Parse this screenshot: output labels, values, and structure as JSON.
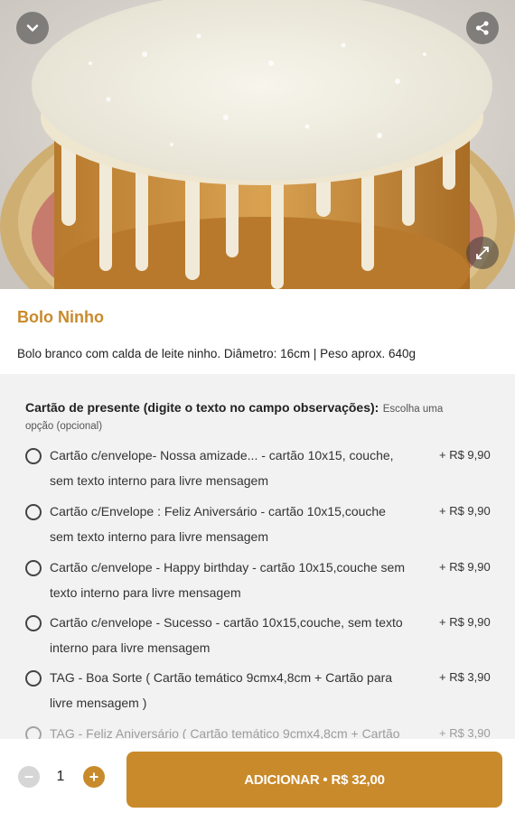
{
  "product": {
    "title": "Bolo Ninho",
    "description": "Bolo branco com calda de leite ninho. Diâmetro: 16cm | Peso aprox. 640g",
    "image_icon": "cake-photo"
  },
  "header_icons": {
    "back": "chevron-down-icon",
    "share": "share-icon",
    "expand": "expand-icon"
  },
  "option_group": {
    "title": "Cartão de presente (digite o texto no campo observações):",
    "hint_line1": "Escolha uma",
    "hint_line2": "opção (opcional)",
    "options": [
      {
        "line1": "Cartão c/envelope- Nossa amizade... - cartão 10x15, couche,",
        "line2": "sem texto interno para livre mensagem",
        "price": "+ R$ 9,90"
      },
      {
        "line1": "Cartão c/Envelope : Feliz Aniversário - cartão 10x15,couche",
        "line2": "sem texto interno para livre mensagem",
        "price": "+ R$ 9,90"
      },
      {
        "line1": "Cartão c/envelope - Happy birthday - cartão 10x15,couche sem",
        "line2": "texto interno para livre mensagem",
        "price": "+ R$ 9,90"
      },
      {
        "line1": "Cartão c/envelope - Sucesso - cartão 10x15,couche, sem texto",
        "line2": "interno para livre mensagem",
        "price": "+ R$ 9,90"
      },
      {
        "line1": "TAG - Boa Sorte ( Cartão temático 9cmx4,8cm + Cartão para",
        "line2": "livre mensagem )",
        "price": "+ R$ 3,90"
      },
      {
        "line1": "TAG - Feliz Aniversário ( Cartão temático 9cmx4,8cm + Cartão",
        "line2": "",
        "price": "+ R$ 3,90"
      }
    ]
  },
  "cart": {
    "quantity": "1",
    "add_label": "ADICIONAR • R$ 32,00"
  },
  "colors": {
    "accent": "#c98a2b",
    "options_bg": "#f2f2f2"
  }
}
